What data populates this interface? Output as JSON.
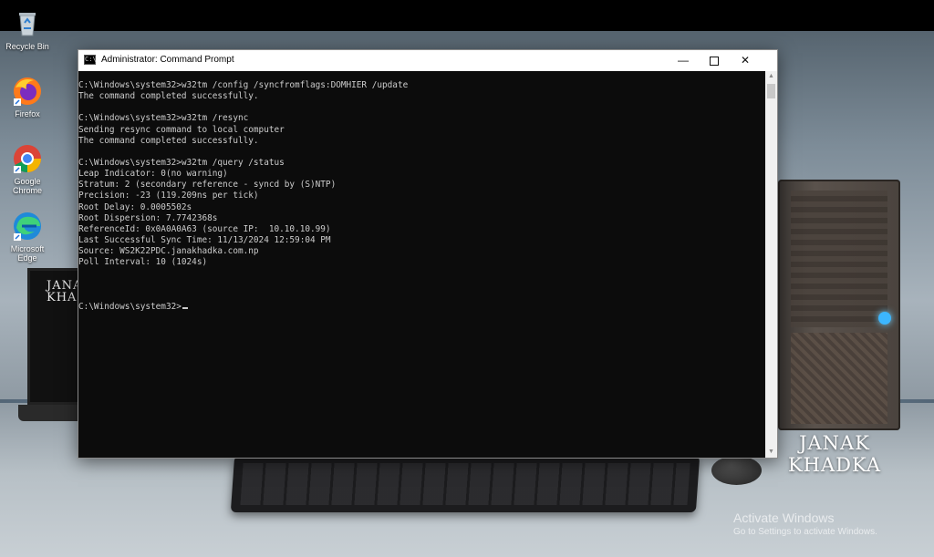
{
  "desktop": {
    "icons": [
      {
        "label": "Recycle Bin",
        "icon": "recycle-bin-icon"
      },
      {
        "label": "Firefox",
        "icon": "firefox-icon"
      },
      {
        "label": "Google Chrome",
        "icon": "chrome-icon"
      },
      {
        "label": "Microsoft Edge",
        "icon": "edge-icon"
      }
    ],
    "laptop_brand": "JANAK KHADKA",
    "watermark_line1": "JANAK",
    "watermark_line2": "KHADKA",
    "activation": {
      "title": "Activate Windows",
      "subtitle": "Go to Settings to activate Windows."
    }
  },
  "window": {
    "title": "Administrator: Command Prompt",
    "controls": {
      "minimize": "—",
      "close": "✕"
    }
  },
  "console": {
    "lines": [
      "C:\\Windows\\system32>w32tm /config /syncfromflags:DOMHIER /update",
      "The command completed successfully.",
      "",
      "C:\\Windows\\system32>w32tm /resync",
      "Sending resync command to local computer",
      "The command completed successfully.",
      "",
      "C:\\Windows\\system32>w32tm /query /status",
      "Leap Indicator: 0(no warning)",
      "Stratum: 2 (secondary reference - syncd by (S)NTP)",
      "Precision: -23 (119.209ns per tick)",
      "Root Delay: 0.0005502s",
      "Root Dispersion: 7.7742368s",
      "ReferenceId: 0x0A0A0A63 (source IP:  10.10.10.99)",
      "Last Successful Sync Time: 11/13/2024 12:59:04 PM",
      "Source: WS2K22PDC.janakhadka.com.np",
      "Poll Interval: 10 (1024s)",
      "",
      "",
      ""
    ],
    "prompt": "C:\\Windows\\system32>"
  },
  "colors": {
    "console_bg": "#0c0c0c",
    "console_fg": "#cccccc",
    "titlebar_bg": "#ffffff",
    "power_led": "#3cb6ff"
  }
}
